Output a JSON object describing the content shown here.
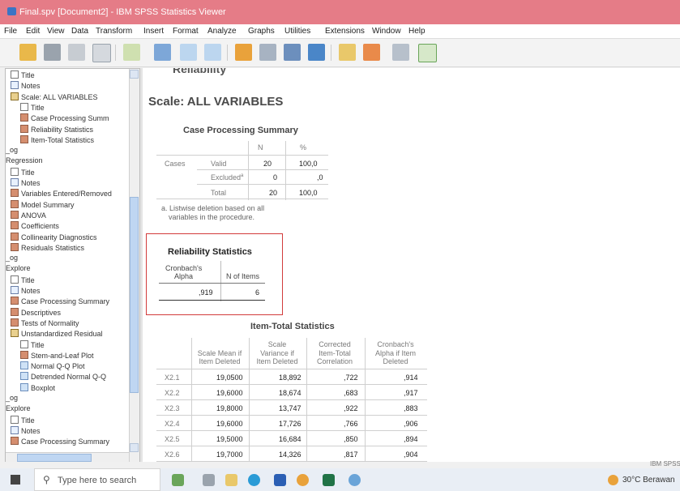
{
  "window": {
    "title": "Final.spv [Document2] - IBM SPSS Statistics Viewer"
  },
  "menu": [
    "File",
    "Edit",
    "View",
    "Data",
    "Transform",
    "Insert",
    "Format",
    "Analyze",
    "Graphs",
    "Utilities",
    "Extensions",
    "Window",
    "Help"
  ],
  "toolbar": {
    "icons": [
      "open-folder-icon",
      "save-icon",
      "print-icon",
      "print-preview-icon",
      "export-icon",
      "recall-dialog-icon",
      "undo-icon",
      "redo-icon",
      "goto-data-icon",
      "goto-case-icon",
      "goto-variable-icon",
      "variables-icon",
      "designate-window-icon",
      "promote-icon",
      "demote-icon",
      "show-all-icon"
    ]
  },
  "nav": {
    "items": [
      {
        "label": "Title",
        "icon": "title"
      },
      {
        "label": "Notes",
        "icon": "note"
      },
      {
        "label": "Scale: ALL VARIABLES",
        "icon": "book"
      },
      {
        "label": "Title",
        "icon": "title"
      },
      {
        "label": "Case Processing Summ",
        "icon": "tbl"
      },
      {
        "label": "Reliability Statistics",
        "icon": "tbl"
      },
      {
        "label": "Item-Total Statistics",
        "icon": "tbl"
      },
      {
        "label": "_og",
        "icon": ""
      },
      {
        "label": "Regression",
        "icon": ""
      },
      {
        "label": "Title",
        "icon": "title"
      },
      {
        "label": "Notes",
        "icon": "note"
      },
      {
        "label": "Variables Entered/Removed",
        "icon": "tbl"
      },
      {
        "label": "Model Summary",
        "icon": "tbl"
      },
      {
        "label": "ANOVA",
        "icon": "tbl"
      },
      {
        "label": "Coefficients",
        "icon": "tbl"
      },
      {
        "label": "Collinearity Diagnostics",
        "icon": "tbl"
      },
      {
        "label": "Residuals Statistics",
        "icon": "tbl"
      },
      {
        "label": "_og",
        "icon": ""
      },
      {
        "label": "Explore",
        "icon": ""
      },
      {
        "label": "Title",
        "icon": "title"
      },
      {
        "label": "Notes",
        "icon": "note"
      },
      {
        "label": "Case Processing Summary",
        "icon": "tbl"
      },
      {
        "label": "Descriptives",
        "icon": "tbl"
      },
      {
        "label": "Tests of Normality",
        "icon": "tbl"
      },
      {
        "label": "Unstandardized Residual",
        "icon": "book"
      },
      {
        "label": "Title",
        "icon": "title"
      },
      {
        "label": "Stem-and-Leaf Plot",
        "icon": "tbl"
      },
      {
        "label": "Normal Q-Q Plot",
        "icon": "chart"
      },
      {
        "label": "Detrended Normal Q-Q",
        "icon": "chart"
      },
      {
        "label": "Boxplot",
        "icon": "chart"
      },
      {
        "label": "_og",
        "icon": ""
      },
      {
        "label": "Explore",
        "icon": ""
      },
      {
        "label": "Title",
        "icon": "title"
      },
      {
        "label": "Notes",
        "icon": "note"
      },
      {
        "label": "Case Processing Summary",
        "icon": "tbl"
      }
    ]
  },
  "output": {
    "heading_cut": "Reliability",
    "scale_title": "Scale: ALL VARIABLES",
    "cps": {
      "title": "Case Processing Summary",
      "col_n": "N",
      "col_pct": "%",
      "row_group": "Cases",
      "rows": [
        {
          "label": "Valid",
          "n": "20",
          "pct": "100,0"
        },
        {
          "label": "Excluded",
          "sup": "a",
          "n": "0",
          "pct": ",0"
        },
        {
          "label": "Total",
          "n": "20",
          "pct": "100,0"
        }
      ],
      "footnote_1": "a. Listwise deletion based on all",
      "footnote_2": "variables in the procedure."
    },
    "rel": {
      "title": "Reliability Statistics",
      "col1_line1": "Cronbach's",
      "col1_line2": "Alpha",
      "col2": "N of Items",
      "alpha": ",919",
      "n_items": "6"
    },
    "itemtotal": {
      "title": "Item-Total Statistics",
      "headers": [
        [
          "Scale Mean if",
          "Item Deleted"
        ],
        [
          "Scale",
          "Variance if",
          "Item Deleted"
        ],
        [
          "Corrected",
          "Item-Total",
          "Correlation"
        ],
        [
          "Cronbach's",
          "Alpha if Item",
          "Deleted"
        ]
      ],
      "rows": [
        {
          "label": "X2.1",
          "mean": "19,0500",
          "var": "18,892",
          "corr": ",722",
          "alpha": ",914"
        },
        {
          "label": "X2.2",
          "mean": "19,6000",
          "var": "18,674",
          "corr": ",683",
          "alpha": ",917"
        },
        {
          "label": "X2.3",
          "mean": "19,8000",
          "var": "13,747",
          "corr": ",922",
          "alpha": ",883"
        },
        {
          "label": "X2.4",
          "mean": "19,6000",
          "var": "17,726",
          "corr": ",766",
          "alpha": ",906"
        },
        {
          "label": "X2.5",
          "mean": "19,5000",
          "var": "16,684",
          "corr": ",850",
          "alpha": ",894"
        },
        {
          "label": "X2.6",
          "mean": "19,7000",
          "var": "14,326",
          "corr": ",817",
          "alpha": ",904"
        }
      ]
    }
  },
  "status": {
    "text": "IBM SPSS"
  },
  "taskbar": {
    "search_placeholder": "Type here to search",
    "weather": "30°C  Berawan"
  },
  "colors": {
    "titlebar": "#e57c87",
    "highlight_box": "#d23b3b"
  }
}
